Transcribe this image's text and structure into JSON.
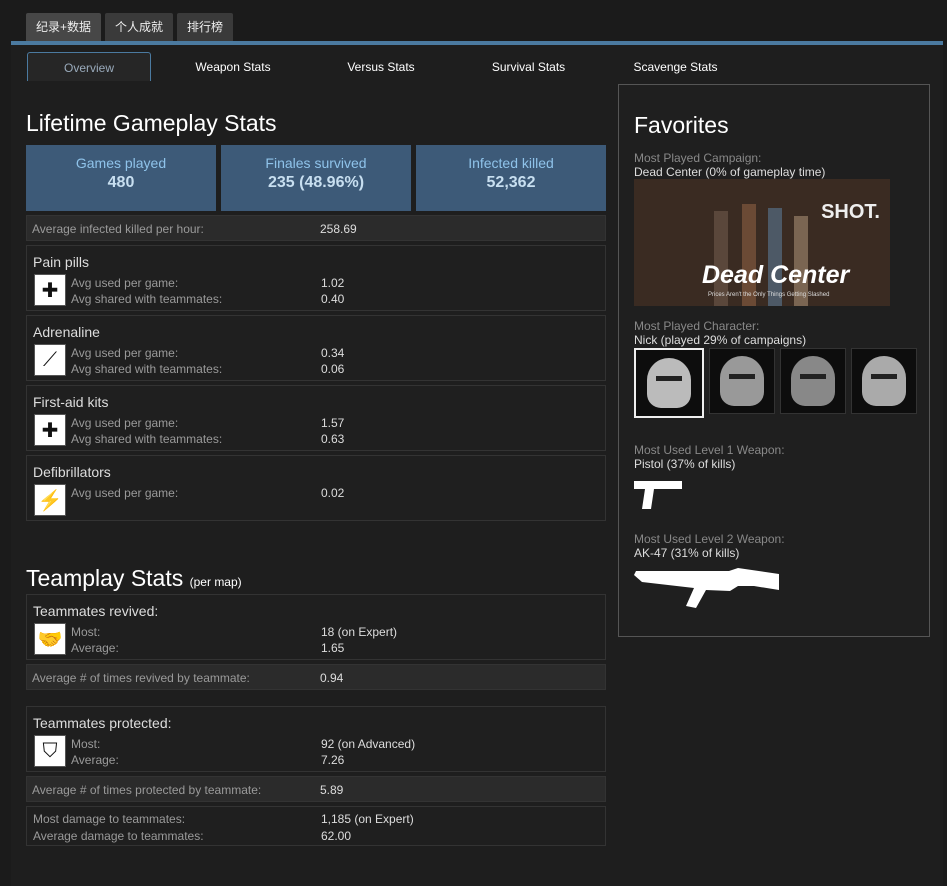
{
  "top_tabs": [
    "纪录+数据",
    "个人成就",
    "排行榜"
  ],
  "subtabs": [
    "Overview",
    "Weapon Stats",
    "Versus Stats",
    "Survival Stats",
    "Scavenge Stats"
  ],
  "lifetime": {
    "title": "Lifetime Gameplay Stats",
    "cards": [
      {
        "label": "Games played",
        "value": "480"
      },
      {
        "label": "Finales survived",
        "value": "235 (48.96%)"
      },
      {
        "label": "Infected killed",
        "value": "52,362"
      }
    ],
    "avg_infected": {
      "label": "Average infected killed per hour:",
      "value": "258.69"
    }
  },
  "items": [
    {
      "title": "Pain pills",
      "icon": "pill-bottle-icon",
      "stats": [
        [
          "Avg used per game:",
          "1.02"
        ],
        [
          "Avg shared with teammates:",
          "0.40"
        ]
      ]
    },
    {
      "title": "Adrenaline",
      "icon": "syringe-icon",
      "stats": [
        [
          "Avg used per game:",
          "0.34"
        ],
        [
          "Avg shared with teammates:",
          "0.06"
        ]
      ]
    },
    {
      "title": "First-aid kits",
      "icon": "medkit-icon",
      "stats": [
        [
          "Avg used per game:",
          "1.57"
        ],
        [
          "Avg shared with teammates:",
          "0.63"
        ]
      ]
    },
    {
      "title": "Defibrillators",
      "icon": "defib-icon",
      "stats": [
        [
          "Avg used per game:",
          "0.02"
        ]
      ]
    }
  ],
  "teamplay": {
    "title": "Teamplay Stats",
    "subtitle": "(per map)",
    "revived": {
      "title": "Teammates revived:",
      "most_label": "Most:",
      "most": "18 (on Expert)",
      "avg_label": "Average:",
      "avg": "1.65"
    },
    "revived_by": {
      "label": "Average # of times revived by teammate:",
      "value": "0.94"
    },
    "protected": {
      "title": "Teammates protected:",
      "most_label": "Most:",
      "most": "92 (on Advanced)",
      "avg_label": "Average:",
      "avg": "7.26"
    },
    "protected_by": {
      "label": "Average # of times protected by teammate:",
      "value": "5.89"
    },
    "damage": {
      "most_label": "Most damage to teammates:",
      "most": "1,185 (on Expert)",
      "avg_label": "Average damage to teammates:",
      "avg": "62.00"
    }
  },
  "favorites": {
    "title": "Favorites",
    "campaign_label": "Most Played Campaign:",
    "campaign": "Dead Center (0% of gameplay time)",
    "campaign_title": "Dead Center",
    "campaign_sub": "Prices Aren't the Only Things Getting Slashed",
    "campaign_graffiti": "SHOT.",
    "character_label": "Most Played Character:",
    "character": "Nick (played 29% of campaigns)",
    "weapon1_label": "Most Used Level 1 Weapon:",
    "weapon1": "Pistol (37% of kills)",
    "weapon2_label": "Most Used Level 2 Weapon:",
    "weapon2": "AK-47 (31% of kills)"
  }
}
